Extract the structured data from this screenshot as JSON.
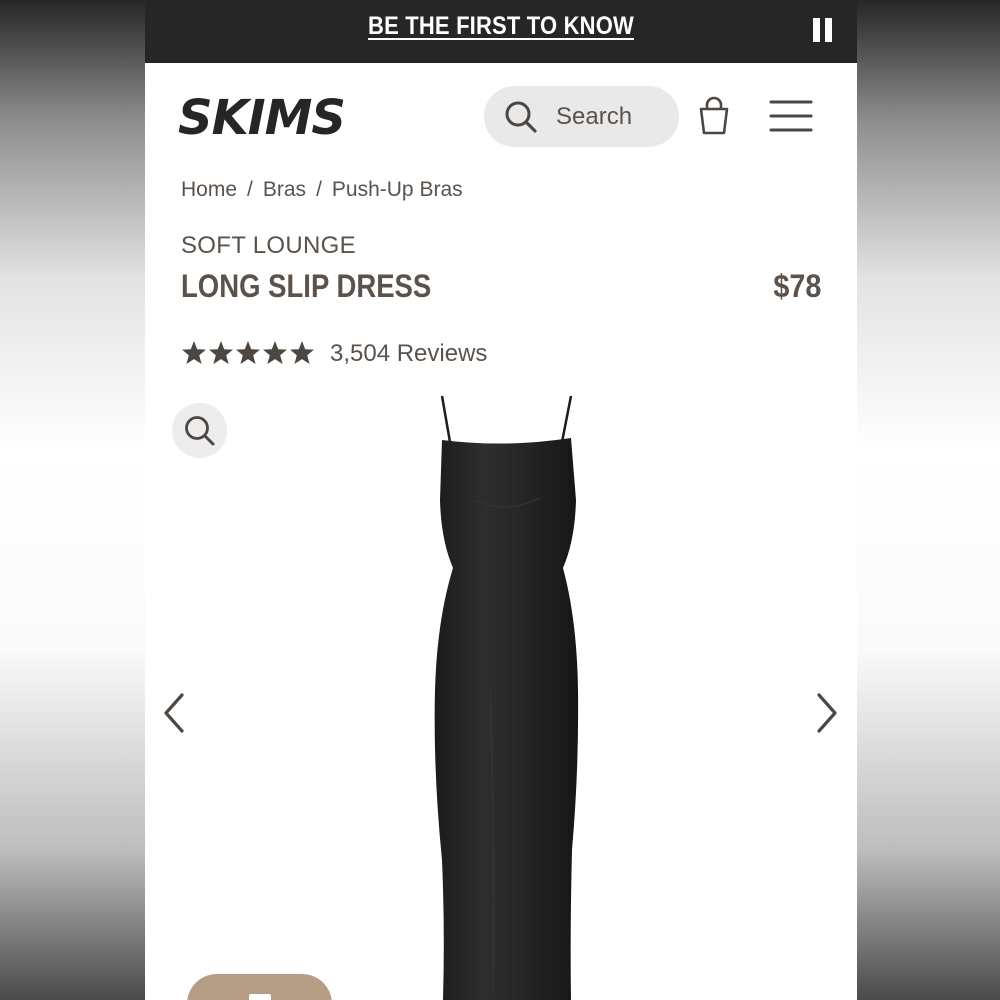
{
  "promo": {
    "text": "BE THE FIRST TO KNOW",
    "pause_icon": "pause-icon"
  },
  "header": {
    "logo_text": "SKIMS",
    "search_placeholder": "Search",
    "icons": [
      "search-icon",
      "shopping-bag-icon",
      "hamburger-menu-icon"
    ]
  },
  "breadcrumb": {
    "items": [
      "Home",
      "Bras",
      "Push-Up Bras"
    ],
    "separator": "/"
  },
  "product": {
    "collection": "SOFT LOUNGE",
    "title": "LONG SLIP DRESS",
    "price": "$78",
    "rating_stars": 5,
    "reviews": "3,504 Reviews",
    "image": "black-long-slip-dress"
  },
  "gallery": {
    "zoom_icon": "zoom-icon",
    "prev_icon": "chevron-left-icon",
    "next_icon": "chevron-right-icon"
  },
  "colors": {
    "promo_bg": "#262626",
    "text_brown": "#5b524b",
    "search_bg": "#e9e9e9",
    "accent_tan": "#b69d86"
  }
}
